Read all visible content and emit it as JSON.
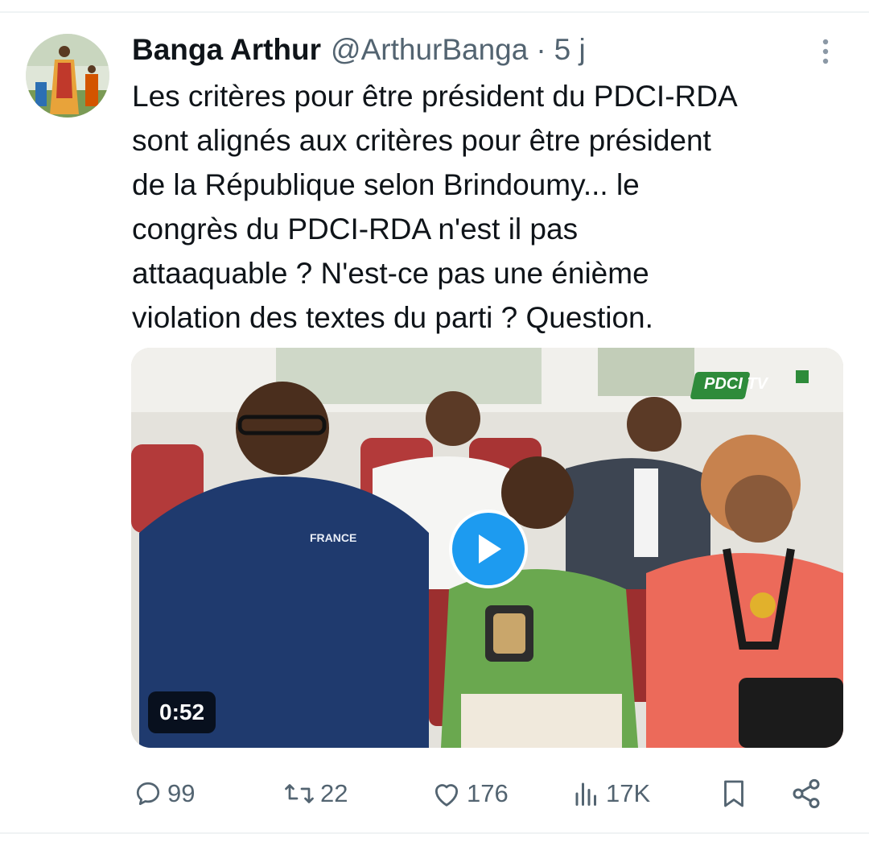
{
  "tweet": {
    "author_name": "Banga Arthur",
    "handle": "@ArthurBanga",
    "separator": "·",
    "time": "5 j",
    "text_lines": [
      "Les critères pour être président du PDCI-RDA",
      "sont alignés aux critères pour être président",
      "de la République selon Brindoumy... le",
      "congrès du PDCI-RDA n'est il pas",
      "attaaquable ?  N'est-ce pas une énième",
      "violation des textes du parti ?  Question."
    ]
  },
  "media": {
    "type": "video",
    "duration": "0:52",
    "watermark": "PDCI TV",
    "shirt_text": "FRANCE"
  },
  "actions": {
    "replies": "99",
    "retweets": "22",
    "likes": "176",
    "views": "17K"
  },
  "icons": [
    "more-vertical-icon",
    "play-icon",
    "reply-icon",
    "retweet-icon",
    "like-icon",
    "views-icon",
    "bookmark-icon",
    "share-icon"
  ],
  "colors": {
    "accent": "#1d9bf0",
    "muted": "#536471",
    "text": "#0f1419"
  }
}
